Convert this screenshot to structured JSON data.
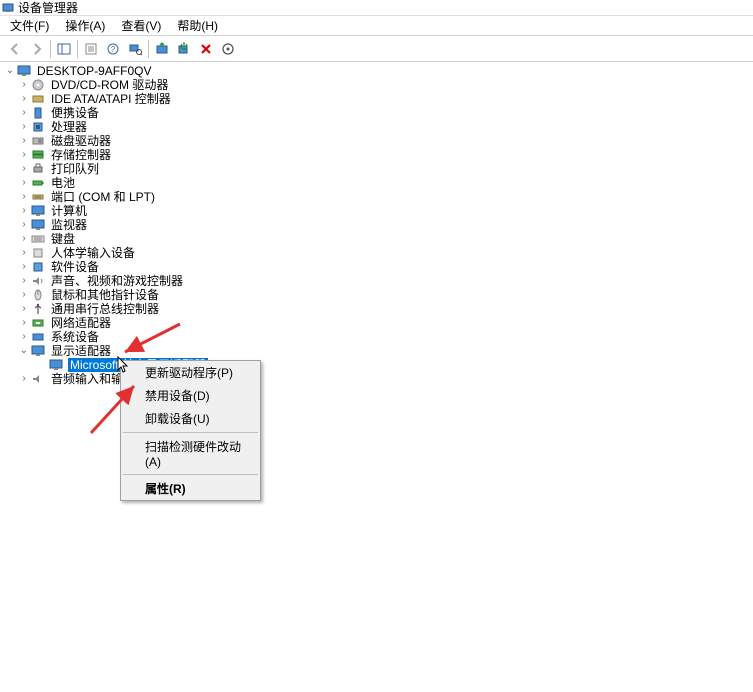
{
  "app": {
    "title": "设备管理器"
  },
  "menu": {
    "file": "文件(F)",
    "action": "操作(A)",
    "view": "查看(V)",
    "help": "帮助(H)"
  },
  "root": {
    "computer": "DESKTOP-9AFF0QV"
  },
  "categories": {
    "dvd": "DVD/CD-ROM 驱动器",
    "ide": "IDE ATA/ATAPI 控制器",
    "portable": "便携设备",
    "processor": "处理器",
    "disk": "磁盘驱动器",
    "storage": "存储控制器",
    "printqueue": "打印队列",
    "battery": "电池",
    "ports": "端口 (COM 和 LPT)",
    "computer_cat": "计算机",
    "monitor": "监视器",
    "keyboard": "键盘",
    "hid": "人体学输入设备",
    "software": "软件设备",
    "sound": "声音、视频和游戏控制器",
    "mouse": "鼠标和其他指针设备",
    "usb": "通用串行总线控制器",
    "network": "网络适配器",
    "system": "系统设备",
    "display": "显示适配器",
    "audio": "音频输入和输出"
  },
  "devices": {
    "basic_display": "Microsoft 基本显示适配器"
  },
  "context": {
    "update": "更新驱动程序(P)",
    "disable": "禁用设备(D)",
    "uninstall": "卸载设备(U)",
    "scan": "扫描检测硬件改动(A)",
    "properties": "属性(R)"
  }
}
